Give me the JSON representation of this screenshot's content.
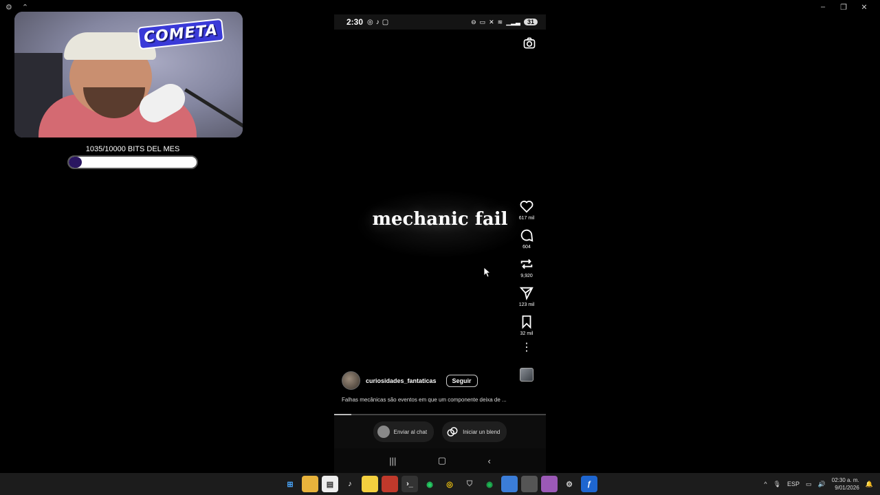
{
  "window": {
    "left_icons": [
      "gear-icon",
      "pin-icon"
    ],
    "controls": [
      "minimize",
      "restore",
      "close"
    ]
  },
  "stream_overlay": {
    "logo_text": "COMETA",
    "bits_label": "1035/10000 BITS DEL MES",
    "bits_current": 1035,
    "bits_goal": 10000,
    "bar_fill_color": "#2a1660"
  },
  "phone": {
    "status": {
      "time": "2:30",
      "app_icons": [
        "instagram-icon",
        "tiktok-icon",
        "twitch-icon"
      ],
      "battery": "31"
    },
    "video": {
      "title": "mechanic fail",
      "progress": 0.08
    },
    "actions": {
      "likes": "617 mil",
      "comments": "604",
      "reposts": "9,920",
      "shares": "123 mil",
      "saves": "32 mil"
    },
    "post": {
      "username": "curiosidades_fantaticas",
      "follow_label": "Seguir",
      "caption": "Falhas mecânicas são eventos em que um componente deixa de ..."
    },
    "bottom": {
      "send_chat": "Enviar al chat",
      "start_blend": "Iniciar un blend"
    }
  },
  "taskbar": {
    "apps": [
      "windows-start",
      "file-explorer",
      "microsoft-store",
      "tiktok",
      "sticky-notes",
      "media-app",
      "terminal",
      "whatsapp",
      "chrome",
      "shield-app",
      "spotify",
      "photos",
      "calculator",
      "dev-app",
      "settings-app",
      "firefox-app"
    ],
    "language": "ESP",
    "time": "02:30 a. m.",
    "date": "9/01/2026"
  }
}
